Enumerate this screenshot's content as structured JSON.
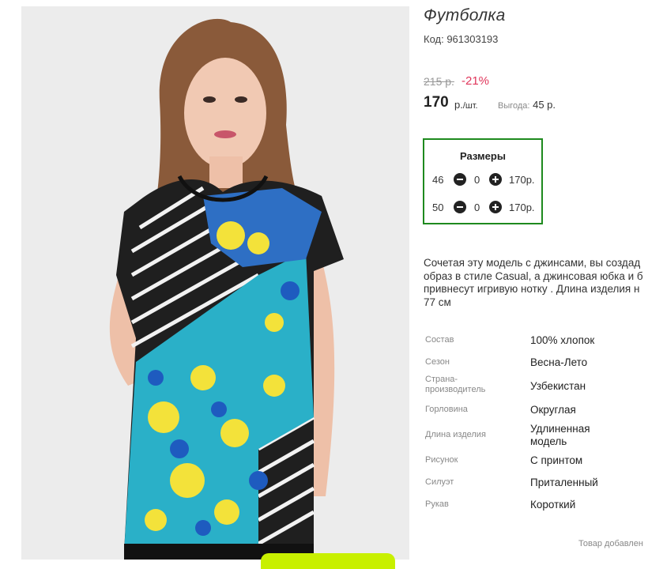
{
  "product": {
    "title": "Футболка",
    "code": "Код: 961303193",
    "old_price": "215 р.",
    "discount": "-21%",
    "price": "170",
    "unit_main": "р.",
    "unit_suffix": "/шт.",
    "savings_label": "Выгода:",
    "savings_value": "45 р."
  },
  "sizes": {
    "title": "Размеры",
    "rows": [
      {
        "size": "46",
        "qty": "0",
        "price": "170р."
      },
      {
        "size": "50",
        "qty": "0",
        "price": "170р."
      }
    ]
  },
  "description": {
    "lines": [
      "Сочетая эту модель с джинсами, вы создад",
      "образ в стиле Casual, а джинсовая юбка и б",
      "привнесут игривую нотку . Длина изделия н",
      "77 см"
    ]
  },
  "properties": [
    {
      "key": "Состав",
      "value": "100% хлопок"
    },
    {
      "key": "Сезон",
      "value": "Весна-Лето"
    },
    {
      "key": "Страна-производитель",
      "value": "Узбекистан"
    },
    {
      "key": "Горловина",
      "value": "Округлая"
    },
    {
      "key": "Длина изделия",
      "value": "Удлиненная модель"
    },
    {
      "key": "Рисунок",
      "value": "С принтом"
    },
    {
      "key": "Силуэт",
      "value": "Приталенный"
    },
    {
      "key": "Рукав",
      "value": "Короткий"
    }
  ],
  "footer": {
    "added": "Товар добавлен"
  },
  "colors": {
    "accent_border": "#1e8a1e",
    "discount": "#e0365b",
    "green_tab": "#c8f000"
  }
}
